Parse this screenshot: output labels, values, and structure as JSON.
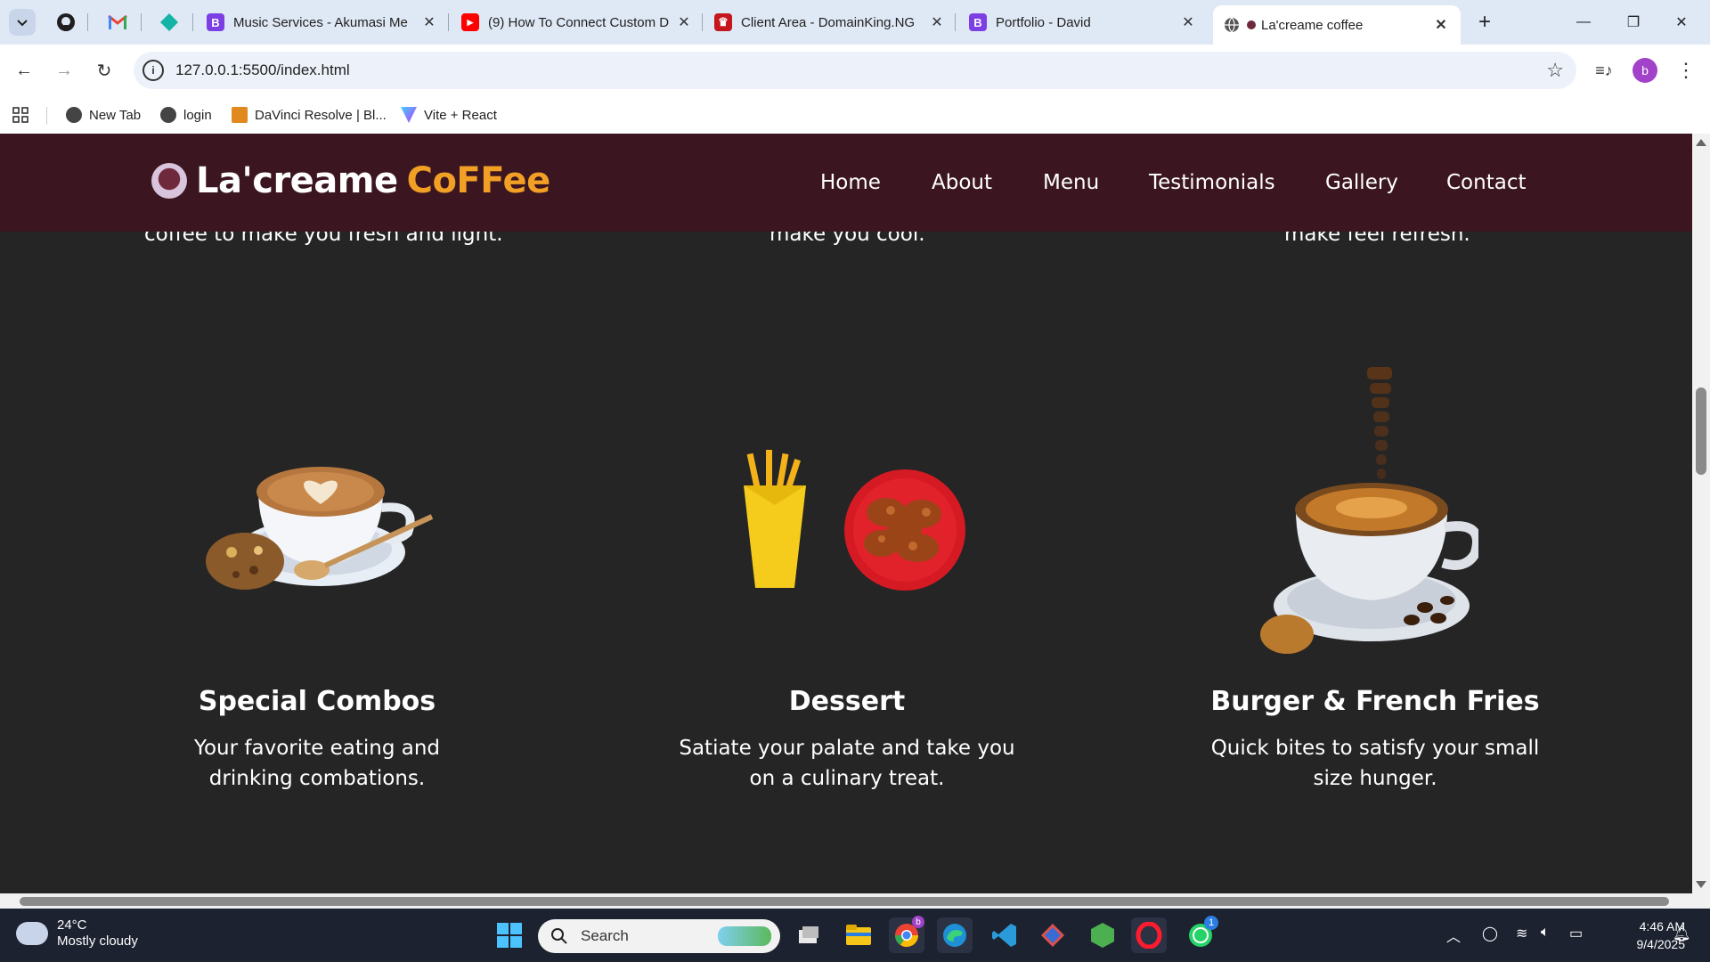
{
  "browser": {
    "tabs": [
      {
        "title": "Music Services - Akumasi Me",
        "favicon_letter": "B",
        "favicon_color": "#7b3fe4"
      },
      {
        "title": "(9) How To Connect Custom D",
        "favicon_letter": "▶",
        "favicon_color": "#ff0000"
      },
      {
        "title": "Client Area - DomainKing.NG",
        "favicon_letter": "♛",
        "favicon_color": "#c4161c"
      },
      {
        "title": "Portfolio - David",
        "favicon_letter": "B",
        "favicon_color": "#7b3fe4"
      },
      {
        "title": "La'creame coffee",
        "favicon_letter": "",
        "favicon_color": "#6e2a3c",
        "active": true
      }
    ],
    "url": "127.0.0.1:5500/index.html",
    "profile_initial": "b",
    "bookmarks": [
      "New Tab",
      "login",
      "DaVinci Resolve | Bl...",
      "Vite + React"
    ]
  },
  "site": {
    "logo_white": "La'creame",
    "logo_orange": "CoFFee",
    "nav": [
      "Home",
      "About",
      "Menu",
      "Testimonials",
      "Gallery",
      "Contact"
    ],
    "peek_text": [
      "coffee to make you fresh and light.",
      "make you cool.",
      "make feel refresh."
    ],
    "cards": [
      {
        "title": "Special Combos",
        "desc": "Your favorite eating and drinking combations."
      },
      {
        "title": "Dessert",
        "desc": "Satiate your palate and take you on a culinary treat."
      },
      {
        "title": "Burger & French Fries",
        "desc": "Quick bites to satisfy your small size hunger."
      }
    ],
    "colors": {
      "header": "#3b1620",
      "body": "#252525",
      "accent": "#f2a025"
    }
  },
  "taskbar": {
    "temperature": "24°C",
    "weather": "Mostly cloudy",
    "search_placeholder": "Search",
    "time": "4:46 AM",
    "date": "9/4/2025",
    "whatsapp_badge": "1",
    "chrome_badge": "b"
  }
}
